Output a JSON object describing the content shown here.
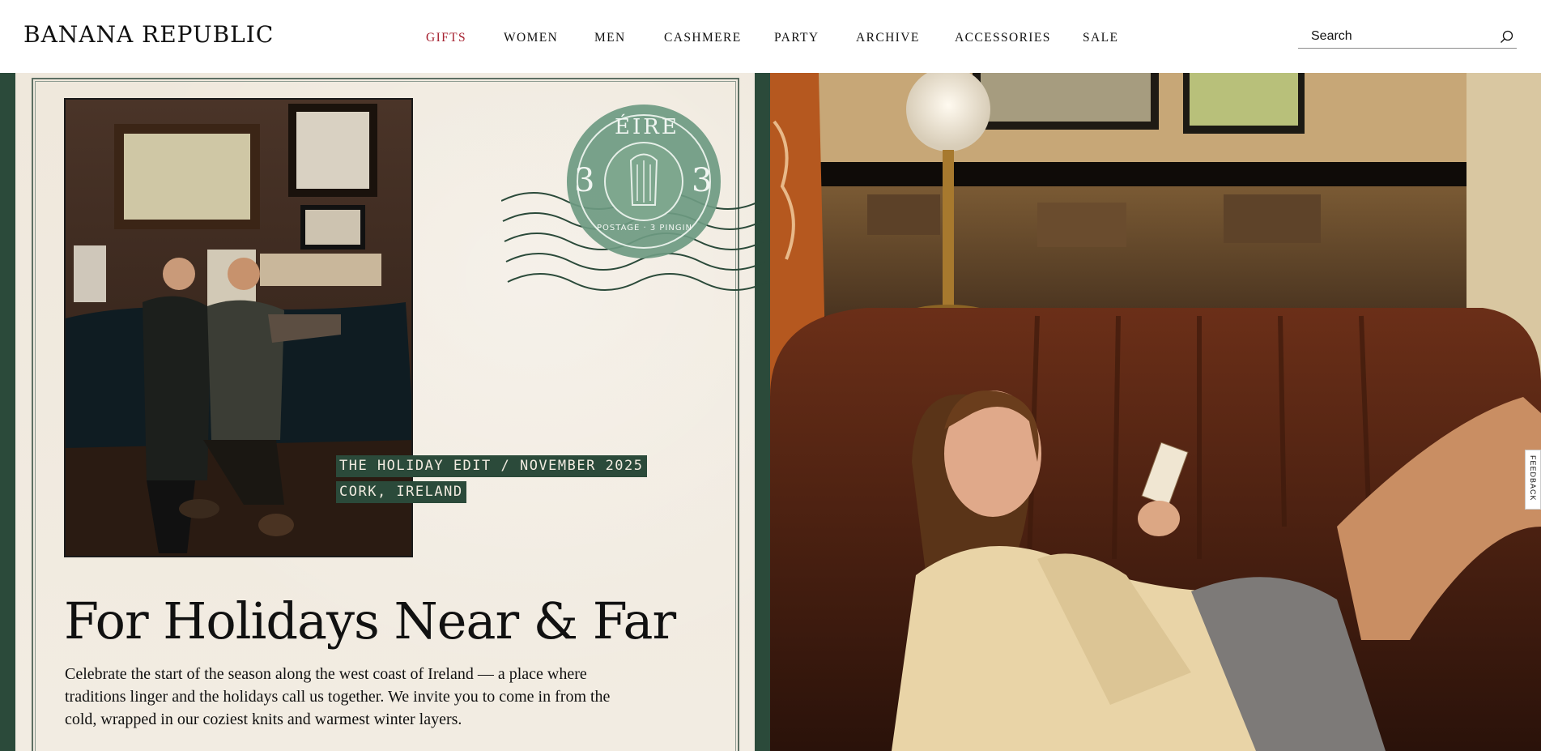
{
  "header": {
    "logo_text": "BANANA REPUBLIC",
    "nav": [
      {
        "label": "GIFTS",
        "accent": true
      },
      {
        "label": "WOMEN",
        "accent": false
      },
      {
        "label": "MEN",
        "accent": false
      },
      {
        "label": "CASHMERE",
        "accent": false
      },
      {
        "label": "PARTY",
        "accent": false
      },
      {
        "label": "ARCHIVE",
        "accent": false
      },
      {
        "label": "ACCESSORIES",
        "accent": false
      },
      {
        "label": "SALE",
        "accent": false
      }
    ],
    "search": {
      "placeholder": "Search",
      "value": "",
      "icon": "search-icon"
    }
  },
  "hero": {
    "tag_line1": "THE HOLIDAY EDIT / NOVEMBER 2025",
    "tag_line2": "CORK, IRELAND",
    "headline": "For Holidays Near & Far",
    "body": "Celebrate the start of the season along the west coast of Ireland — a place where traditions linger and the holidays call us together. We invite you to come in from the cold, wrapped in our coziest knits and warmest winter layers.",
    "stamp": {
      "top_text": "ÉIRE",
      "value_left": "3",
      "value_right": "3",
      "bottom_text": "POSTAGE · 3 PINGIN",
      "icon": "harp-icon"
    }
  },
  "feedback_label": "FEEDBACK",
  "colors": {
    "accent_red": "#a51f2e",
    "forest_green": "#2b4a3a",
    "paper": "#f1ebe0",
    "stamp_green": "#6e9a82"
  }
}
